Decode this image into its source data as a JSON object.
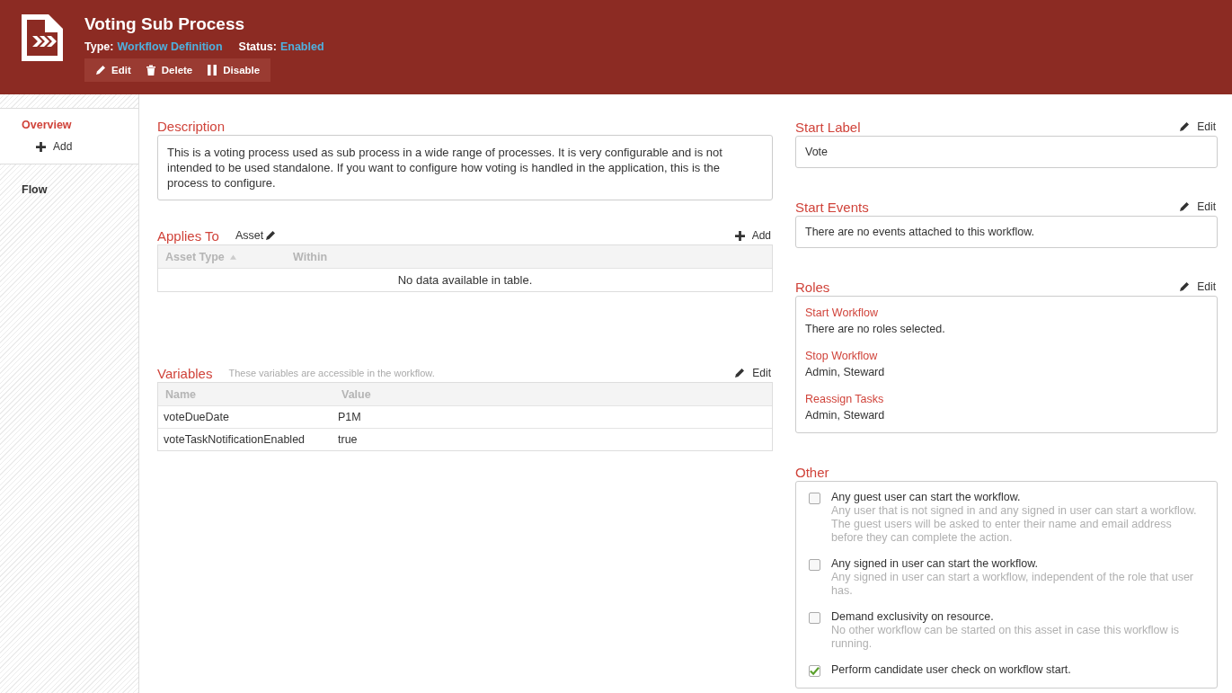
{
  "header": {
    "title": "Voting Sub Process",
    "type_label": "Type:",
    "type_value": "Workflow Definition",
    "status_label": "Status:",
    "status_value": "Enabled",
    "actions": [
      {
        "label": "Edit",
        "kind": "edit"
      },
      {
        "label": "Delete",
        "kind": "delete"
      },
      {
        "label": "Disable",
        "kind": "disable"
      }
    ]
  },
  "sidebar": {
    "items": [
      {
        "label": "Overview",
        "selected": true,
        "action": "Add"
      },
      {
        "label": "Flow",
        "selected": false
      }
    ]
  },
  "description": {
    "title": "Description",
    "text": "This is a voting process used as sub process in a wide range of processes. It is very configurable and is not intended to be used standalone. If you want to configure how voting is handled in the application, this is the process to configure."
  },
  "applies_to": {
    "title": "Applies To",
    "asset_link": "Asset",
    "add": "Add",
    "columns": [
      {
        "label": "Asset Type",
        "sorted": true
      },
      {
        "label": "Within",
        "sorted": false
      }
    ],
    "empty": "No data available in table."
  },
  "variables": {
    "title": "Variables",
    "hint": "These variables are accessible in the workflow.",
    "edit": "Edit",
    "columns": [
      "Name",
      "Value"
    ],
    "rows": [
      [
        "voteDueDate",
        "P1M"
      ],
      [
        "voteTaskNotificationEnabled",
        "true"
      ]
    ]
  },
  "start_label": {
    "title": "Start Label",
    "edit": "Edit",
    "value": "Vote"
  },
  "start_events": {
    "title": "Start Events",
    "edit": "Edit",
    "text": "There are no events attached to this workflow."
  },
  "roles": {
    "title": "Roles",
    "edit": "Edit",
    "groups": [
      {
        "name": "Start Workflow",
        "value": "There are no roles selected."
      },
      {
        "name": "Stop Workflow",
        "value": "Admin, Steward"
      },
      {
        "name": "Reassign Tasks",
        "value": "Admin, Steward"
      }
    ]
  },
  "other": {
    "title": "Other",
    "options": [
      {
        "label": "Any guest user can start the workflow.",
        "description": "Any user that is not signed in and any signed in user can start a workflow. The guest users will be asked to enter their name and email address before they can complete the action.",
        "checked": false
      },
      {
        "label": "Any signed in user can start the workflow.",
        "description": "Any signed in user can start a workflow, independent of the role that user has.",
        "checked": false
      },
      {
        "label": "Demand exclusivity on resource.",
        "description": "No other workflow can be started on this asset in case this workflow is running.",
        "checked": false
      },
      {
        "label": "Perform candidate user check on workflow start.",
        "checked": true
      }
    ]
  }
}
